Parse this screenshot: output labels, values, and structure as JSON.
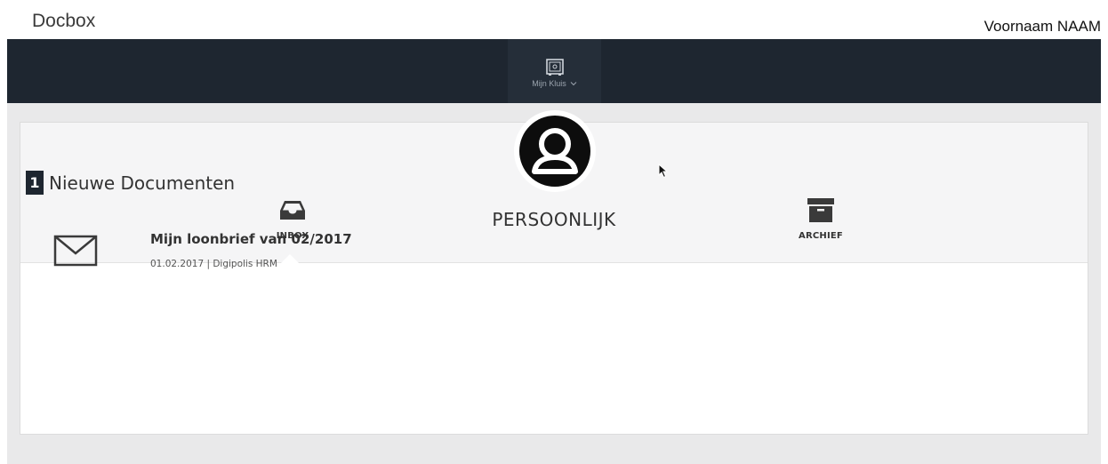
{
  "header": {
    "app_title": "Docbox",
    "user_name": "Voornaam NAAM"
  },
  "navbar": {
    "items": [
      {
        "label": "Mijn Kluis",
        "icon": "safe-icon",
        "has_dropdown": true
      }
    ]
  },
  "vault": {
    "title": "PERSOONLIJK",
    "avatar_icon": "user-icon",
    "tabs": [
      {
        "label": "INBOX",
        "icon": "inbox-icon",
        "active": true
      },
      {
        "label": "ARCHIEF",
        "icon": "archive-box-icon",
        "active": false
      }
    ]
  },
  "section": {
    "count": "1",
    "label": "Nieuwe Documenten"
  },
  "documents": [
    {
      "title": "Mijn loonbrief van 02/2017",
      "meta": "01.02.2017 | Digipolis HRM",
      "icon": "envelope-icon"
    }
  ],
  "colors": {
    "navbar_bg": "#1e2630",
    "nav_active_bg": "#252e39",
    "page_bg": "#e9e9ea",
    "card_header_bg": "#f5f5f6",
    "badge_bg": "#1e2630"
  }
}
